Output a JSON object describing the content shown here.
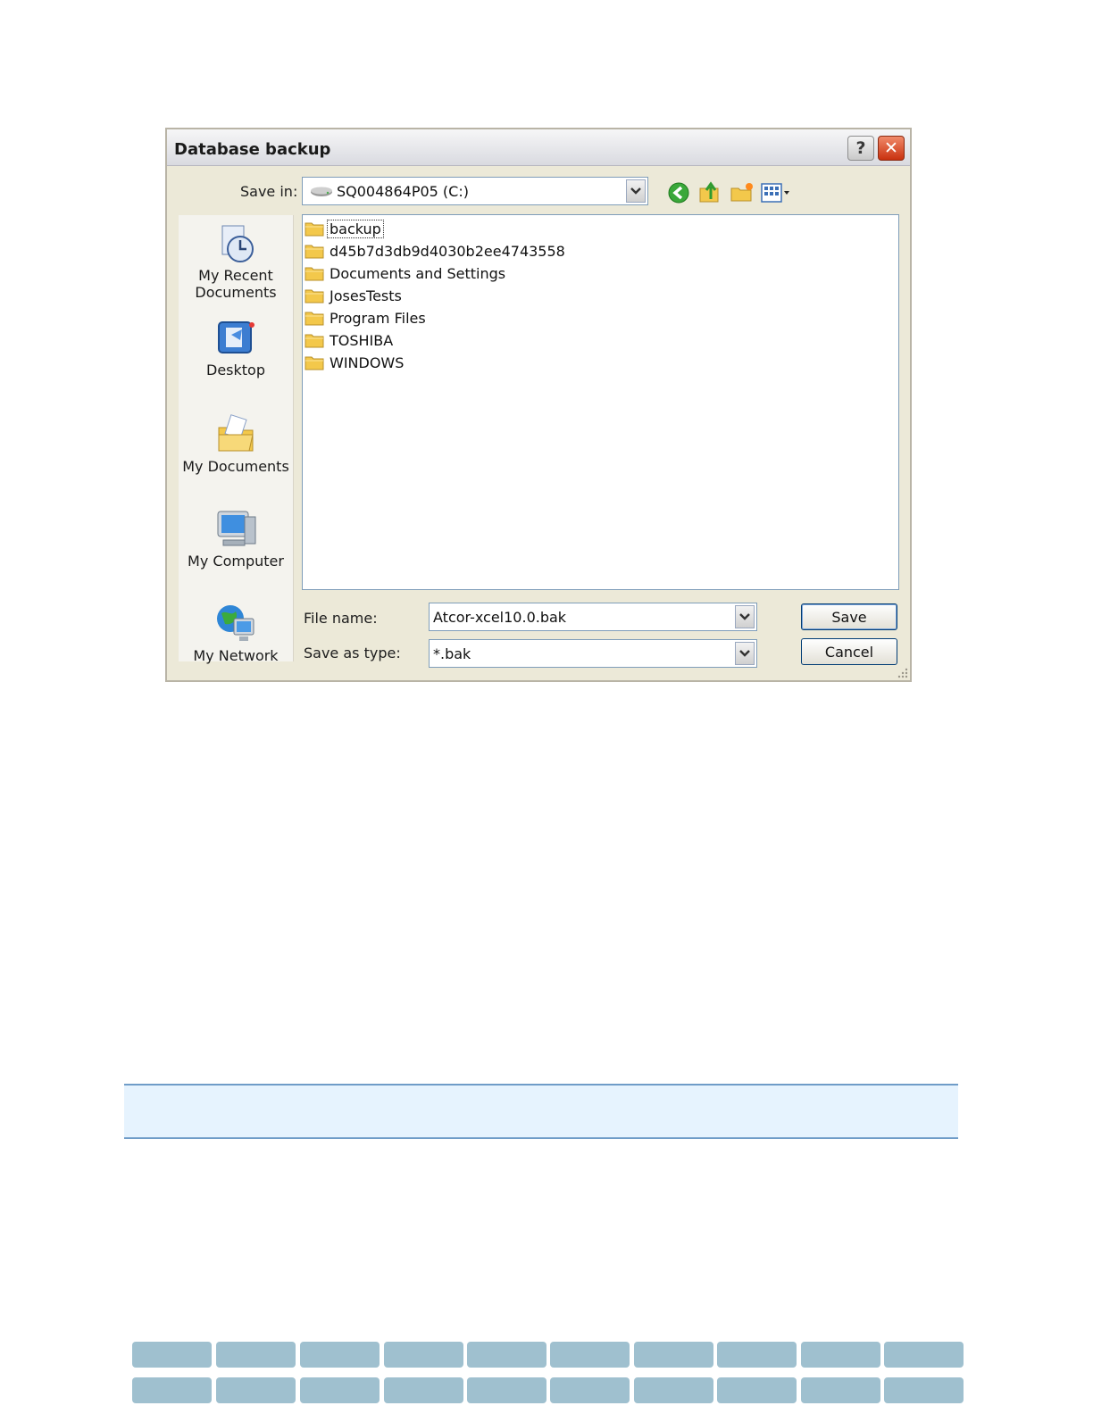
{
  "dialog": {
    "title": "Database backup",
    "help_label": "?",
    "close_label": "✕",
    "save_in_label": "Save in:",
    "save_in_value": "SQ004864P05 (C:)"
  },
  "places": [
    {
      "label_line1": "My Recent",
      "label_line2": "Documents",
      "icon": "recent-documents-icon"
    },
    {
      "label_line1": "Desktop",
      "label_line2": "",
      "icon": "desktop-icon"
    },
    {
      "label_line1": "My Documents",
      "label_line2": "",
      "icon": "my-documents-icon"
    },
    {
      "label_line1": "My Computer",
      "label_line2": "",
      "icon": "my-computer-icon"
    },
    {
      "label_line1": "My Network",
      "label_line2": "",
      "icon": "my-network-icon"
    }
  ],
  "files": [
    {
      "name": "backup"
    },
    {
      "name": "d45b7d3db9d4030b2ee4743558"
    },
    {
      "name": "Documents and Settings"
    },
    {
      "name": "JosesTests"
    },
    {
      "name": "Program Files"
    },
    {
      "name": "TOSHIBA"
    },
    {
      "name": "WINDOWS"
    }
  ],
  "form": {
    "file_name_label": "File name:",
    "file_name_value": "Atcor-xcel10.0.bak",
    "save_as_type_label": "Save as type:",
    "save_as_type_value": "*.bak",
    "save_label": "Save",
    "cancel_label": "Cancel"
  },
  "colors": {
    "accent": "#003c74",
    "band": "#e6f3fe",
    "tile": "#9fc0cf"
  }
}
